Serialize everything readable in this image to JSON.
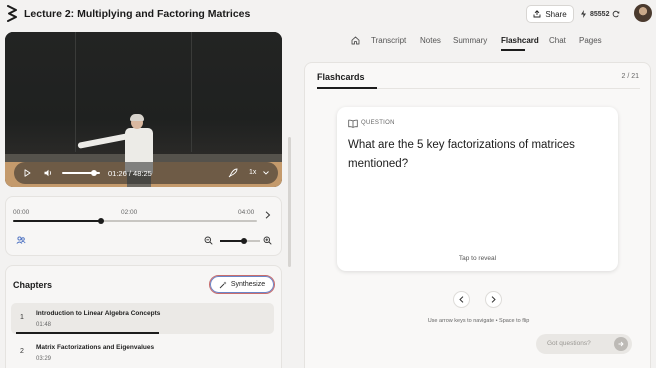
{
  "header": {
    "title": "Lecture 2: Multiplying and Factoring Matrices",
    "share_label": "Share",
    "credits": "85552"
  },
  "video": {
    "time_display": "01:26 / 48:25",
    "speed": "1x",
    "volume_level": 0.85
  },
  "timeline": {
    "labels": [
      "00:00",
      "02:00",
      "04:00"
    ],
    "position": 0.36,
    "zoom_level": 0.6
  },
  "chapters": {
    "title": "Chapters",
    "synthesize_label": "Synthesize",
    "items": [
      {
        "number": "1",
        "title": "Introduction to Linear Algebra Concepts",
        "time": "01:48",
        "progress": 0.55
      },
      {
        "number": "2",
        "title": "Matrix Factorizations and Eigenvalues",
        "time": "03:29"
      }
    ]
  },
  "tabs": [
    "Transcript",
    "Notes",
    "Summary",
    "Flashcard",
    "Chat",
    "Pages"
  ],
  "active_tab": "Flashcard",
  "flashcards": {
    "title": "Flashcards",
    "count": "2 / 21",
    "card_label": "QUESTION",
    "question": "What are the 5 key factorizations of matrices mentioned?",
    "tap_hint": "Tap to reveal",
    "nav_hint": "Use arrow keys to navigate • Space to flip"
  },
  "chat": {
    "placeholder": "Got questions?"
  },
  "colors": {
    "accent": "#1c1c1c",
    "synth_border_a": "#c86d6d",
    "synth_border_b": "#6a86c9"
  }
}
